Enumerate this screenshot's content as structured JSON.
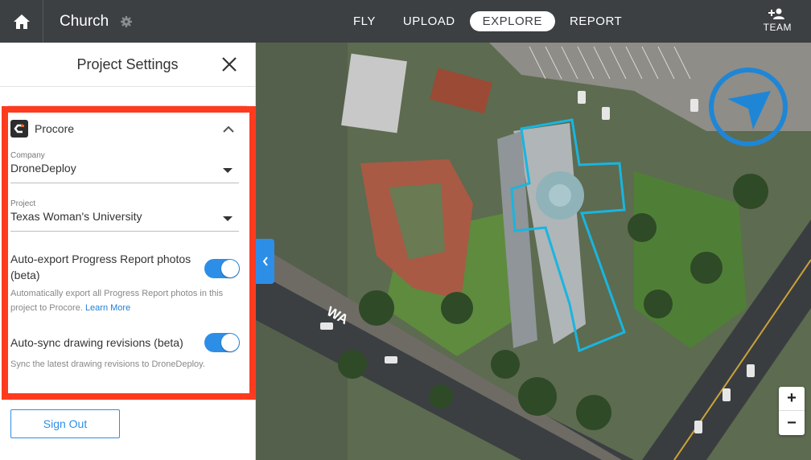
{
  "topbar": {
    "project_name": "Church",
    "nav": [
      {
        "label": "FLY",
        "active": false
      },
      {
        "label": "UPLOAD",
        "active": false
      },
      {
        "label": "EXPLORE",
        "active": true
      },
      {
        "label": "REPORT",
        "active": false
      }
    ],
    "team_label": "TEAM"
  },
  "panel": {
    "title": "Project Settings",
    "procore": {
      "label": "Procore",
      "company": {
        "label": "Company",
        "value": "DroneDeploy"
      },
      "project": {
        "label": "Project",
        "value": "Texas Woman's University"
      },
      "auto_export": {
        "label": "Auto-export Progress Report photos (beta)",
        "enabled": true,
        "help": "Automatically export all Progress Report photos in this project to Procore.",
        "learn_more": "Learn More"
      },
      "auto_sync": {
        "label": "Auto-sync drawing revisions (beta)",
        "enabled": true,
        "help": "Sync the latest drawing revisions to DroneDeploy."
      }
    },
    "sign_out": "Sign Out"
  },
  "map": {
    "street_label": "WA",
    "zoom_in": "+",
    "zoom_out": "−"
  },
  "colors": {
    "accent": "#2d8ee8",
    "highlight": "#ff3b1f",
    "topbar": "#3c4043",
    "outline": "#19b5e0"
  }
}
